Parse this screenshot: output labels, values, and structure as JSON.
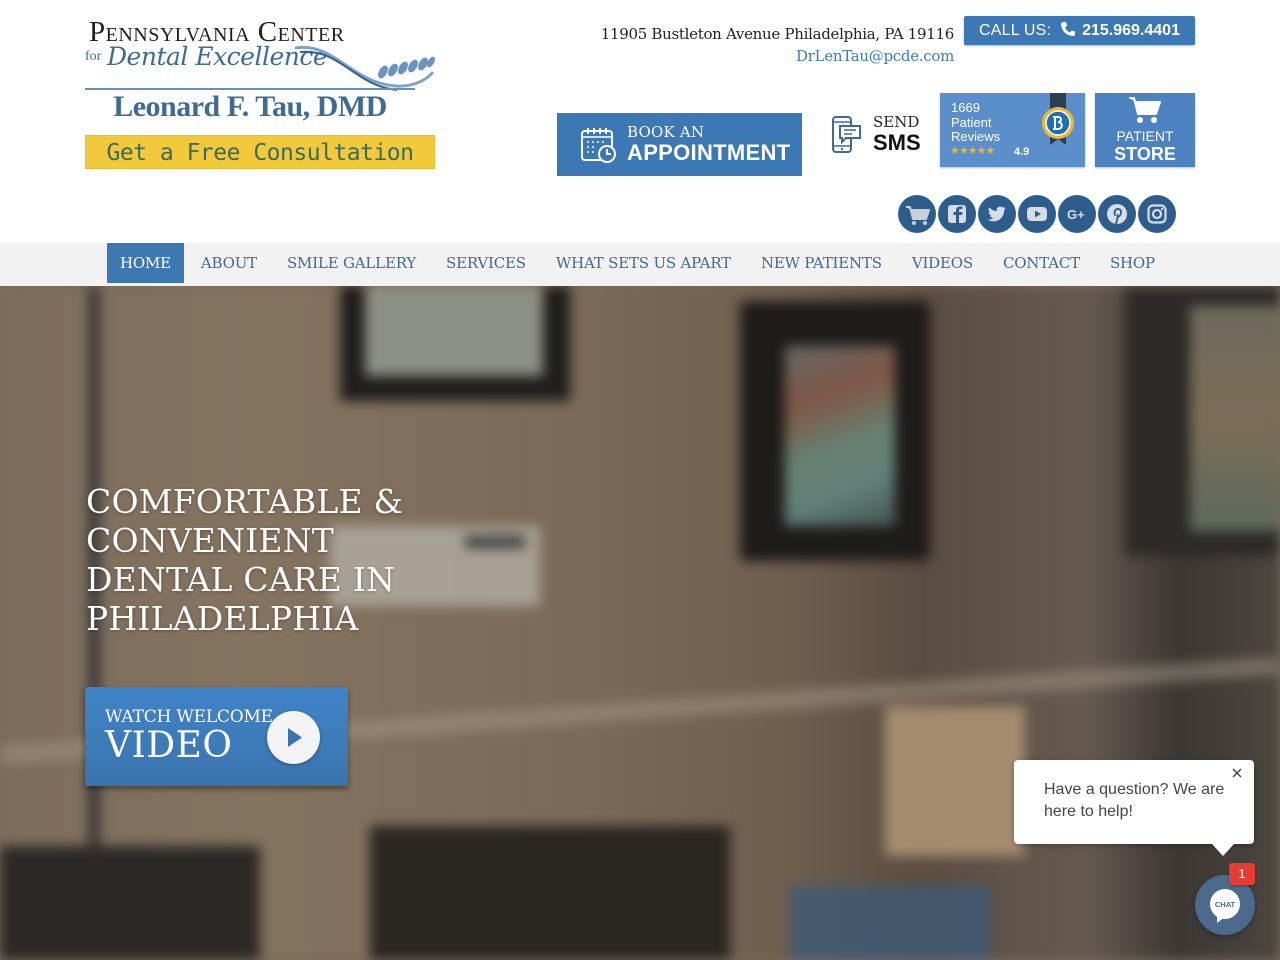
{
  "logo": {
    "line1": "Pennsylvania Center",
    "for": "for",
    "line2": "Dental Excellence",
    "doctor": "Leonard F. Tau, DMD"
  },
  "consultation_button": "Get a Free Consultation",
  "contact": {
    "address": "11905 Bustleton Avenue Philadelphia, PA 19116",
    "email": "DrLenTau@pcde.com",
    "call_label": "CALL US:",
    "phone": "215.969.4401",
    "phone_icon": "phone-icon"
  },
  "appointment_button": {
    "line1": "BOOK AN",
    "line2": "APPOINTMENT",
    "icon": "calendar-clock-icon"
  },
  "sms_button": {
    "line1": "SEND",
    "line2": "SMS",
    "icon": "mobile-message-icon"
  },
  "reviews_widget": {
    "count": "1669",
    "line2": "Patient",
    "line3": "Reviews",
    "stars": "★★★★★",
    "rating": "4.9",
    "rating_value": 4.9,
    "rating_max": 5,
    "icon": "award-badge-icon"
  },
  "store_button": {
    "line1": "PATIENT",
    "line2": "STORE",
    "icon": "cart-icon"
  },
  "social_links": [
    {
      "name": "shop",
      "icon": "cart-icon"
    },
    {
      "name": "facebook",
      "icon": "facebook-icon"
    },
    {
      "name": "twitter",
      "icon": "twitter-icon"
    },
    {
      "name": "youtube",
      "icon": "youtube-icon"
    },
    {
      "name": "google-plus",
      "icon": "google-plus-icon"
    },
    {
      "name": "pinterest",
      "icon": "pinterest-icon"
    },
    {
      "name": "instagram",
      "icon": "instagram-icon"
    }
  ],
  "nav": {
    "items": [
      {
        "label": "HOME",
        "active": true
      },
      {
        "label": "ABOUT",
        "active": false
      },
      {
        "label": "SMILE GALLERY",
        "active": false
      },
      {
        "label": "SERVICES",
        "active": false
      },
      {
        "label": "WHAT SETS US APART",
        "active": false
      },
      {
        "label": "NEW PATIENTS",
        "active": false
      },
      {
        "label": "VIDEOS",
        "active": false
      },
      {
        "label": "CONTACT",
        "active": false
      },
      {
        "label": "SHOP",
        "active": false
      }
    ]
  },
  "hero": {
    "title_lines": [
      "COMFORTABLE &",
      "CONVENIENT",
      "DENTAL CARE IN",
      "PHILADELPHIA"
    ],
    "video_button": {
      "line1": "WATCH WELCOME",
      "line2": "VIDEO",
      "icon": "play-icon"
    }
  },
  "chat": {
    "message": "Have a question? We are here to help!",
    "badge_count": "1",
    "bubble_label": "CHAT",
    "close_icon": "close-icon"
  },
  "colors": {
    "brand_blue": "#3c78b4",
    "nav_text": "#3d6b94",
    "consult_yellow": "#f1c93a",
    "review_blue": "#5b8fcc",
    "social_blue": "#2d5d8c",
    "chat_badge_red": "#e53d32",
    "chat_blue": "#4b6a8e"
  }
}
